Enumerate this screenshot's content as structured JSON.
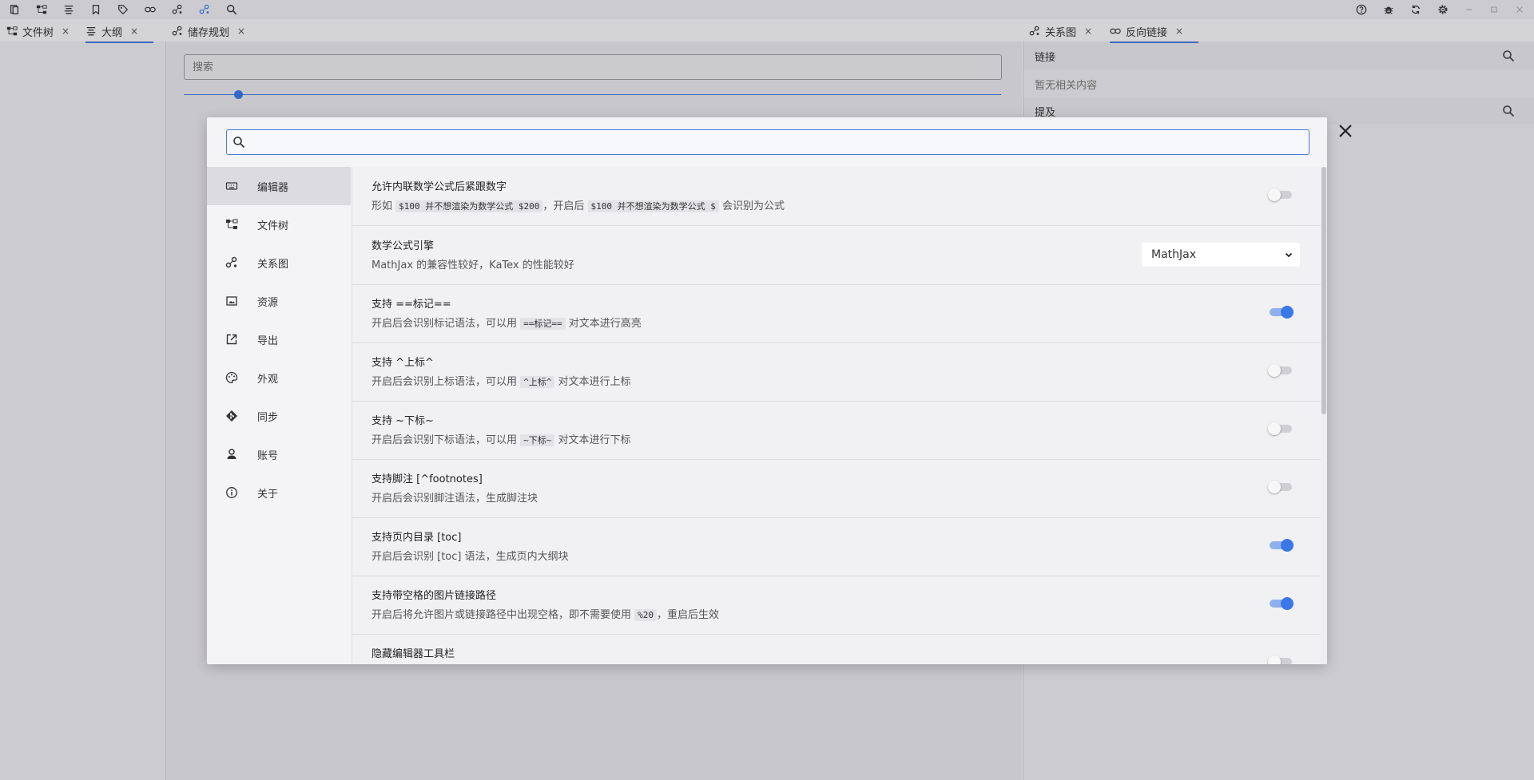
{
  "topbar": {
    "left_icons": [
      "files-icon",
      "file-tree-icon",
      "outline-icon",
      "bookmark-icon",
      "tag-icon",
      "link-icon",
      "graph-icon",
      "graph-active-icon",
      "search-icon"
    ],
    "right_icons": [
      "help-icon",
      "bug-icon",
      "sync-icon",
      "settings-icon"
    ],
    "window_controls": [
      "minimize-icon",
      "maximize-icon",
      "close-window-icon"
    ]
  },
  "left_tabs": [
    {
      "label": "文件树",
      "close": "×"
    },
    {
      "label": "大纲",
      "close": "×"
    }
  ],
  "mid_tab": {
    "label": "储存规划",
    "close": "×"
  },
  "mid_search": {
    "placeholder": "搜索"
  },
  "right_tabs": [
    {
      "label": "关系图",
      "close": "×"
    },
    {
      "label": "反向链接",
      "close": "×"
    }
  ],
  "backlinks": {
    "links_header": "链接",
    "empty_text": "暂无相关内容",
    "mentions_header": "提及"
  },
  "settings": {
    "search_value": "",
    "nav": [
      {
        "label": "编辑器",
        "icon": "keyboard-icon"
      },
      {
        "label": "文件树",
        "icon": "file-tree-icon"
      },
      {
        "label": "关系图",
        "icon": "graph-icon"
      },
      {
        "label": "资源",
        "icon": "image-icon"
      },
      {
        "label": "导出",
        "icon": "export-icon"
      },
      {
        "label": "外观",
        "icon": "palette-icon"
      },
      {
        "label": "同步",
        "icon": "git-icon"
      },
      {
        "label": "账号",
        "icon": "account-icon"
      },
      {
        "label": "关于",
        "icon": "info-icon"
      }
    ],
    "rows": {
      "r0": {
        "title": "允许内联数学公式后紧跟数字",
        "d1": "形如",
        "c1": "$100 并不想渲染为数学公式 $200",
        "d2": "，开启后",
        "c2": "$100 并不想渲染为数学公式 $",
        "d3": "会识别为公式",
        "enabled": false
      },
      "r1": {
        "title": "数学公式引擎",
        "desc": "MathJax 的兼容性较好，KaTex 的性能较好",
        "select_value": "MathJax"
      },
      "r2": {
        "title": "支持 ==标记==",
        "d1": "开启后会识别标记语法，可以用",
        "c1": "==标记==",
        "d2": "对文本进行高亮",
        "enabled": true
      },
      "r3": {
        "title": "支持 ^上标^",
        "d1": "开启后会识别上标语法，可以用",
        "c1": "^上标^",
        "d2": "对文本进行上标",
        "enabled": false
      },
      "r4": {
        "title": "支持 ~下标~",
        "d1": "开启后会识别下标语法，可以用",
        "c1": "~下标~",
        "d2": "对文本进行下标",
        "enabled": false
      },
      "r5": {
        "title": "支持脚注 [^footnotes]",
        "desc": "开启后会识别脚注语法，生成脚注块",
        "enabled": false
      },
      "r6": {
        "title": "支持页内目录 [toc]",
        "desc": "开启后会识别 [toc] 语法，生成页内大纲块",
        "enabled": true
      },
      "r7": {
        "title": "支持带空格的图片链接路径",
        "d1": "开启后将允许图片或链接路径中出现空格，即不需要使用",
        "c1": "%20",
        "d2": "，重启后生效",
        "enabled": true
      },
      "r8": {
        "title": "隐藏编辑器工具栏",
        "enabled": false
      }
    }
  }
}
